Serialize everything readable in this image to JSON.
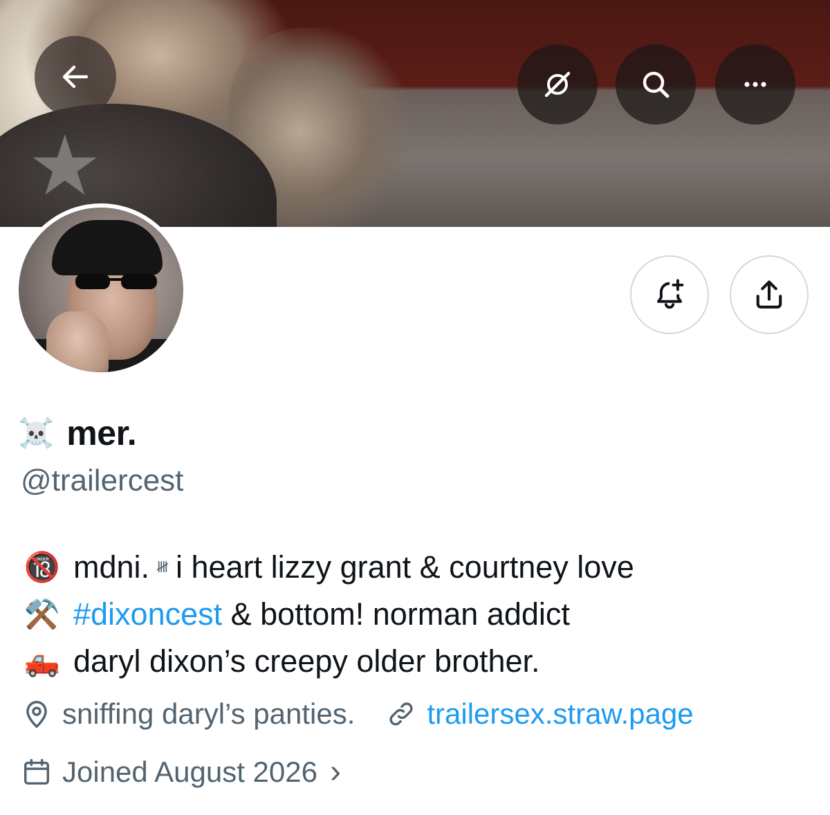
{
  "header": {
    "back_icon": "arrow-left-icon",
    "grok_icon": "grok-icon",
    "search_icon": "search-icon",
    "more_icon": "more-horizontal-icon"
  },
  "profile": {
    "name_emoji": "☠️",
    "display_name": "mer.",
    "handle": "@trailercest",
    "bio": {
      "line1": {
        "emoji": "🔞",
        "text_a": "mdni.",
        "tally": "𝍸",
        "text_b": "i heart lizzy grant & courtney love"
      },
      "line2": {
        "emoji": "⚒️",
        "hashtag": "#dixoncest",
        "text": " & bottom! norman addict"
      },
      "line3": {
        "emoji": "🛻",
        "text": "daryl dixon’s creepy older brother."
      }
    },
    "location": "sniffing daryl’s panties.",
    "website": "trailersex.straw.page",
    "joined": "Joined August 2026",
    "joined_chevron": "›"
  },
  "actions": {
    "notify_icon": "bell-plus-icon",
    "share_icon": "share-icon"
  },
  "colors": {
    "link": "#1d9bf0",
    "secondary_text": "#536471",
    "primary_text": "#0f1419",
    "button_border": "#cfd9de"
  }
}
